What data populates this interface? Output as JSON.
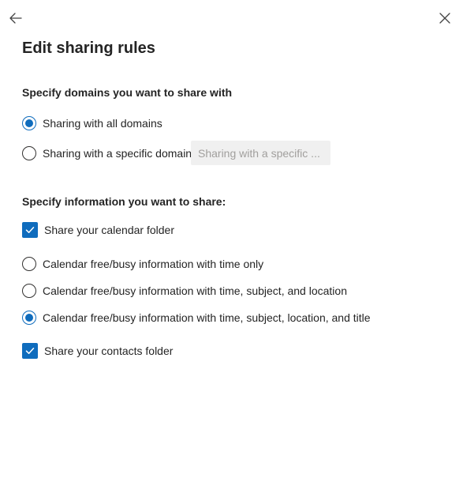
{
  "header": {
    "back_icon": "arrow-left-icon",
    "close_icon": "close-icon",
    "title": "Edit sharing rules"
  },
  "domains": {
    "section_label": "Specify domains you want to share with",
    "options": [
      {
        "label": "Sharing with all domains",
        "checked": true
      },
      {
        "label": "Sharing with a specific domain",
        "checked": false
      }
    ],
    "input": {
      "placeholder": "Sharing with a specific ...",
      "value": ""
    }
  },
  "info": {
    "section_label": "Specify information you want to share:",
    "calendar_folder": {
      "label": "Share your calendar folder",
      "checked": true
    },
    "calendar_options": [
      {
        "label": "Calendar free/busy information with time only",
        "checked": false
      },
      {
        "label": "Calendar free/busy information with time, subject, and location",
        "checked": false
      },
      {
        "label": "Calendar free/busy information with time, subject, location, and title",
        "checked": true
      }
    ],
    "contacts_folder": {
      "label": "Share your contacts folder",
      "checked": true
    }
  },
  "colors": {
    "accent": "#0f6cbd",
    "text": "#242424",
    "input_bg": "#f0f0f0",
    "placeholder": "#a19f9d"
  }
}
